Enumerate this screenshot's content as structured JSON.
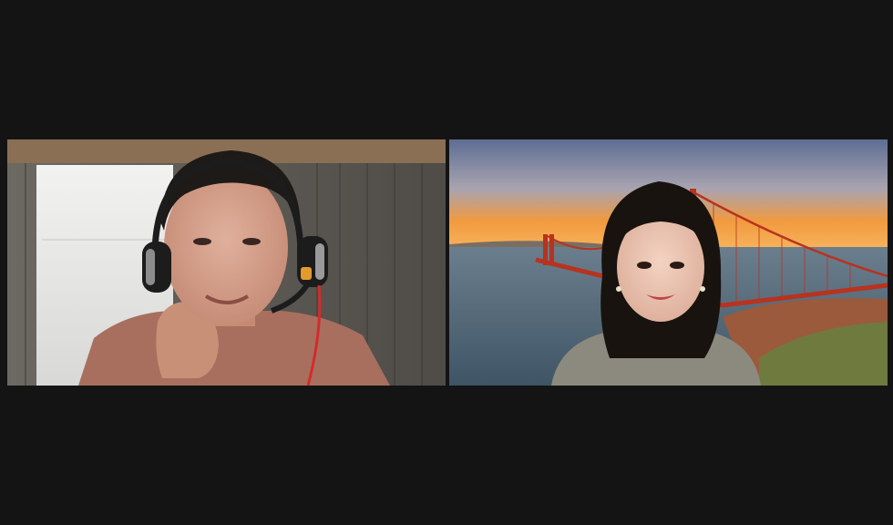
{
  "participants": [
    {
      "id": "participant-1",
      "video_state": "camera-on",
      "background": "real-room",
      "colors": {
        "shirt": "#a86f5e",
        "headset": "#1c1c1c",
        "accent": "#e39b2b"
      }
    },
    {
      "id": "participant-2",
      "video_state": "camera-on",
      "background": "virtual-golden-gate-bridge",
      "colors": {
        "bridge": "#b8331f",
        "sky_top": "#5d6d93",
        "sky_glow": "#f29a3e",
        "water": "#4b6172"
      }
    }
  ],
  "layout": "gallery-view-2-up",
  "colors": {
    "window_background": "#141414"
  }
}
